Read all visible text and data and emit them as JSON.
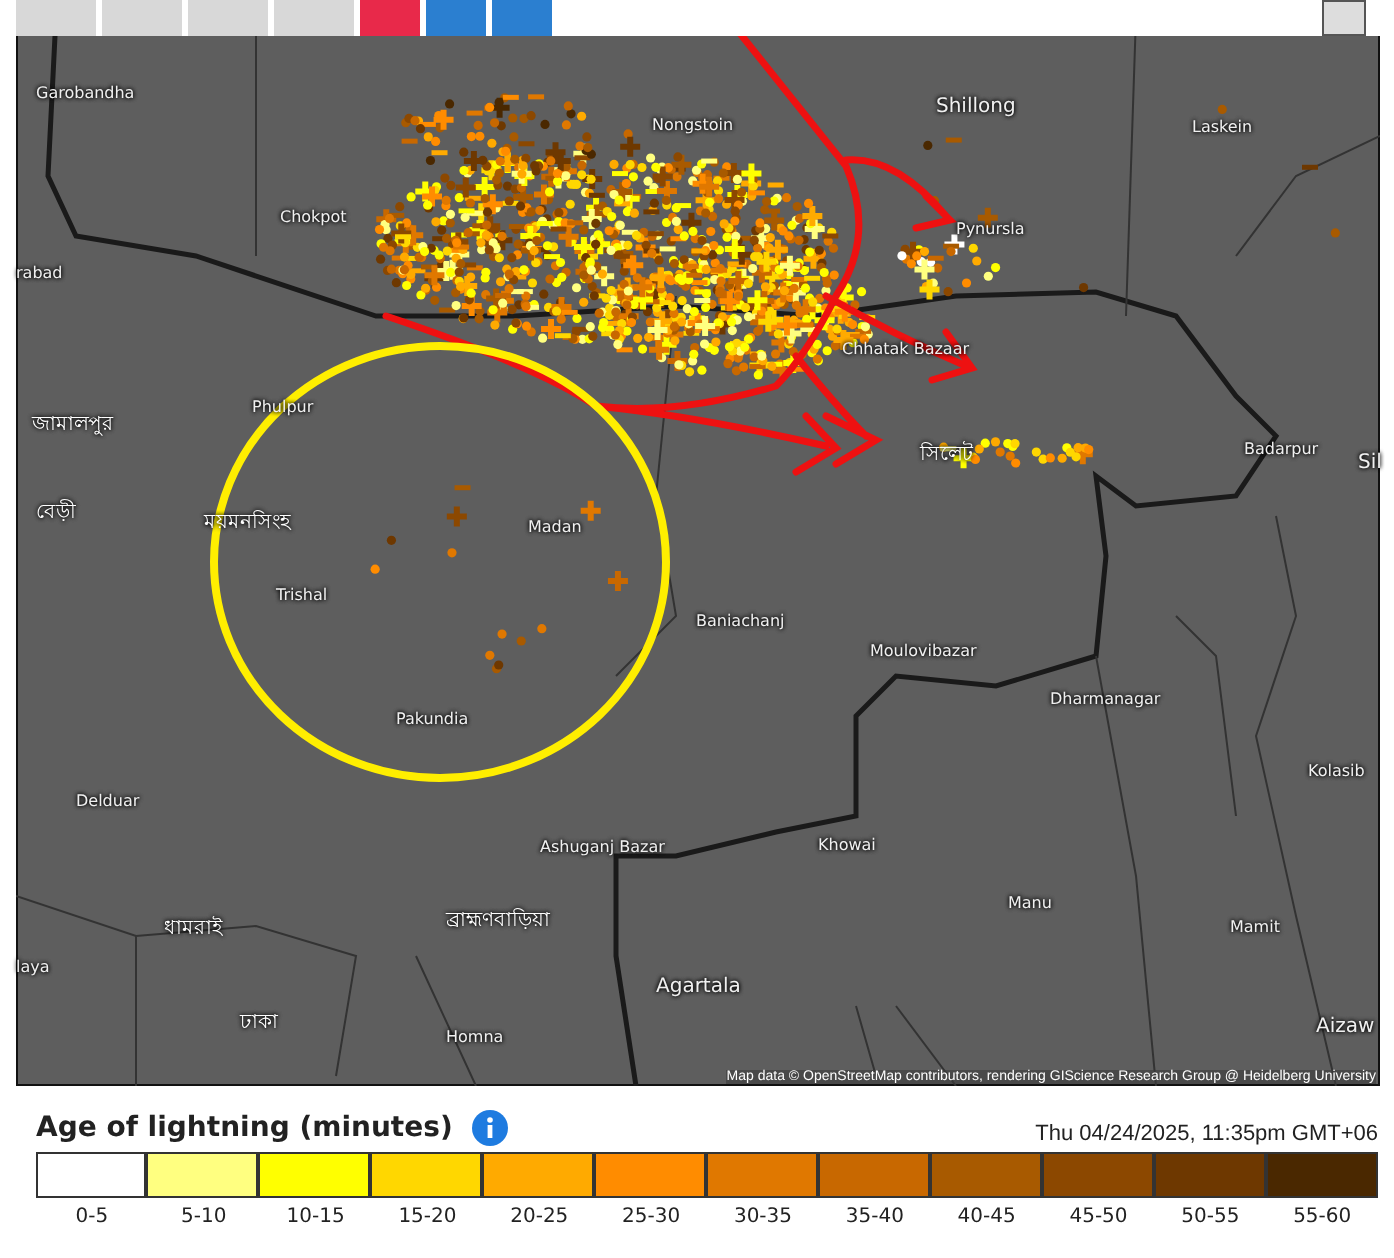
{
  "toolbar": [
    {
      "kind": "plain"
    },
    {
      "kind": "plain"
    },
    {
      "kind": "plain"
    },
    {
      "kind": "plain"
    },
    {
      "kind": "alert"
    },
    {
      "kind": "layer"
    },
    {
      "kind": "layer"
    }
  ],
  "map": {
    "labels": [
      {
        "text": "Garobandha",
        "kind": "town"
      },
      {
        "text": "Nongstoin",
        "kind": "town"
      },
      {
        "text": "Shillong",
        "kind": "city"
      },
      {
        "text": "Laskein",
        "kind": "town"
      },
      {
        "text": "Chokpot",
        "kind": "town"
      },
      {
        "text": "rabad",
        "kind": "town"
      },
      {
        "text": "Pynursla",
        "kind": "town"
      },
      {
        "text": "Chhatak Bazaar",
        "kind": "town"
      },
      {
        "text": "জামালপুর",
        "kind": "region"
      },
      {
        "text": "Phulpur",
        "kind": "town"
      },
      {
        "text": "বেড়ী",
        "kind": "region"
      },
      {
        "text": "ময়মনসিংহ",
        "kind": "region"
      },
      {
        "text": "Madan",
        "kind": "town"
      },
      {
        "text": "সিলেট",
        "kind": "region"
      },
      {
        "text": "Badarpur",
        "kind": "town"
      },
      {
        "text": "Sil",
        "kind": "city"
      },
      {
        "text": "Trishal",
        "kind": "town"
      },
      {
        "text": "Baniachanj",
        "kind": "town"
      },
      {
        "text": "Moulovibazar",
        "kind": "town"
      },
      {
        "text": "Dharmanagar",
        "kind": "town"
      },
      {
        "text": "Pakundia",
        "kind": "town"
      },
      {
        "text": "Kolasib",
        "kind": "town"
      },
      {
        "text": "Delduar",
        "kind": "town"
      },
      {
        "text": "Khowai",
        "kind": "town"
      },
      {
        "text": "Ashuganj Bazar",
        "kind": "town"
      },
      {
        "text": "Manu",
        "kind": "town"
      },
      {
        "text": "ধামরাই",
        "kind": "region"
      },
      {
        "text": "ব্রাহ্মণবাড়িয়া",
        "kind": "region"
      },
      {
        "text": "Mamit",
        "kind": "town"
      },
      {
        "text": "laya",
        "kind": "town"
      },
      {
        "text": "Agartala",
        "kind": "city"
      },
      {
        "text": "ঢাকা",
        "kind": "region"
      },
      {
        "text": "Aizaw",
        "kind": "city"
      },
      {
        "text": "Homna",
        "kind": "town"
      }
    ],
    "attribution": "Map data © OpenStreetMap contributors, rendering GIScience Research Group @ Heidelberg University"
  },
  "legend": {
    "title": "Age of lightning (minutes)",
    "timestamp": "Thu 04/24/2025, 11:35pm GMT+06",
    "bins": [
      {
        "label": "0-5",
        "color": "#ffffff"
      },
      {
        "label": "5-10",
        "color": "#ffff80"
      },
      {
        "label": "10-15",
        "color": "#ffff00"
      },
      {
        "label": "15-20",
        "color": "#ffd700"
      },
      {
        "label": "20-25",
        "color": "#ffaa00"
      },
      {
        "label": "25-30",
        "color": "#ff8c00"
      },
      {
        "label": "30-35",
        "color": "#e07800"
      },
      {
        "label": "35-40",
        "color": "#c86800"
      },
      {
        "label": "40-45",
        "color": "#a85a00"
      },
      {
        "label": "45-50",
        "color": "#8c4800"
      },
      {
        "label": "50-55",
        "color": "#6e3800"
      },
      {
        "label": "55-60",
        "color": "#4a2800"
      }
    ]
  }
}
